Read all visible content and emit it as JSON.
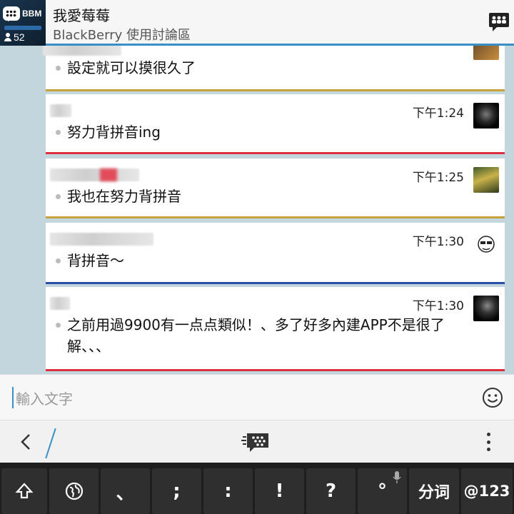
{
  "header": {
    "badge_label": "BBM",
    "member_count": "52",
    "group_name": "我愛莓莓",
    "group_subtitle": "BlackBerry 使用討論區"
  },
  "messages": [
    {
      "time": "",
      "text": "設定就可以摸很久了",
      "line_color": "#c8a238"
    },
    {
      "time": "下午1:24",
      "text": "努力背拼音ing",
      "line_color": "#d9323e"
    },
    {
      "time": "下午1:25",
      "text": "我也在努力背拼音",
      "line_color": "#c8a238"
    },
    {
      "time": "下午1:30",
      "text": "背拼音〜",
      "line_color": "#2b4fa8"
    },
    {
      "time": "下午1:30",
      "text": "之前用過9900有一点点類似！、多了好多內建APP不是很了解、、、",
      "line_color": "#d9323e"
    }
  ],
  "composer": {
    "placeholder": "輸入文字"
  },
  "keyboard": {
    "keys": [
      "、",
      ";",
      ":",
      "!",
      "?",
      "°",
      "分词",
      "@123"
    ]
  },
  "icons": {
    "members": "group-chat-icon",
    "emoji": "smiley-icon",
    "back": "chevron-left-icon",
    "bbm_chat": "bbm-chat-icon",
    "more": "overflow-menu-icon",
    "shift": "shift-icon",
    "globe": "globe-icon",
    "mic": "mic-icon"
  },
  "colors": {
    "accent": "#3a8fc6",
    "background": "#c3d6de",
    "keyboard": "#1e1e1e"
  }
}
